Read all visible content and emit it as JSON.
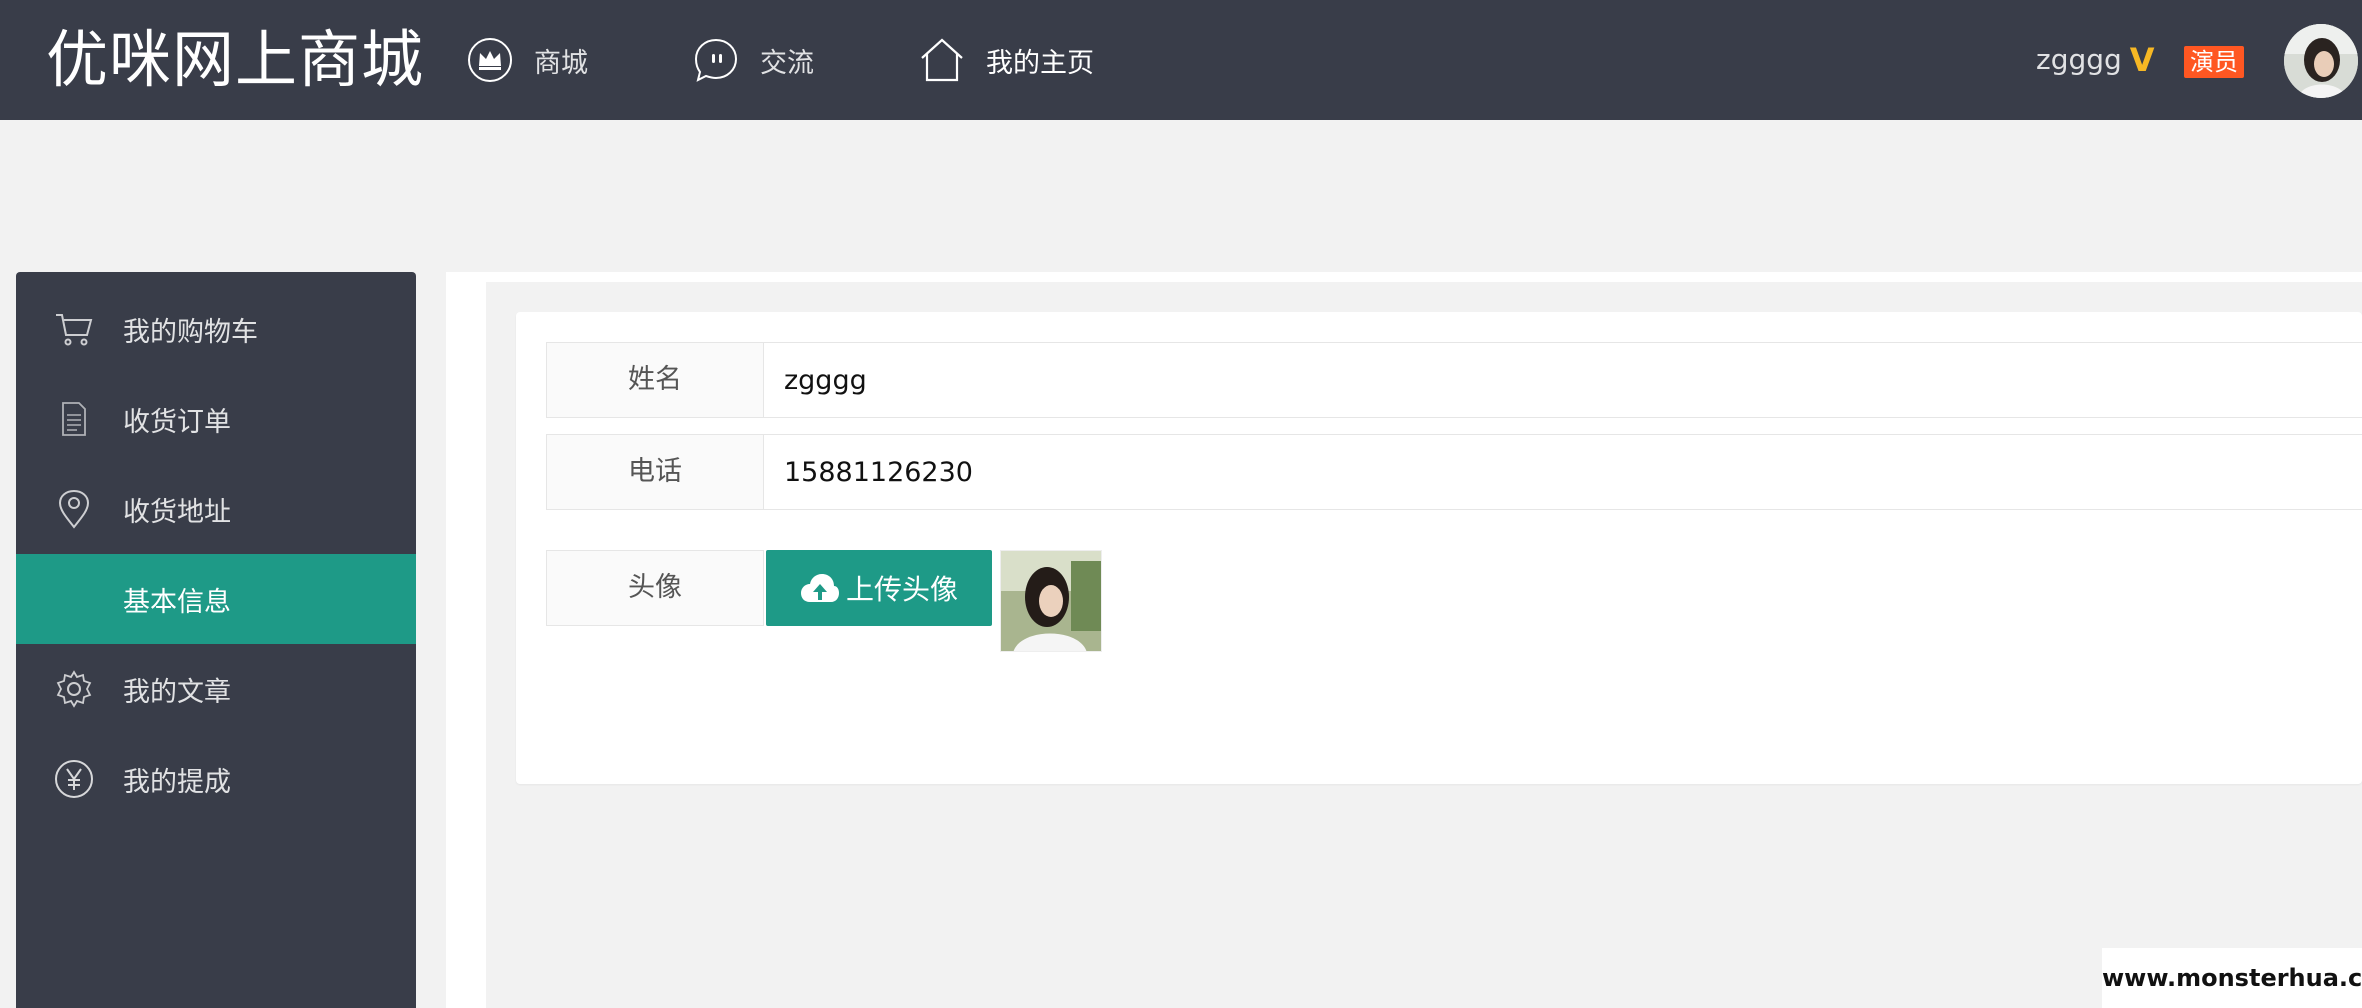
{
  "header": {
    "logo": "优咪网上商城",
    "nav": [
      {
        "label": "商城",
        "icon": "crown-icon"
      },
      {
        "label": "交流",
        "icon": "chat-bubble-icon"
      },
      {
        "label": "我的主页",
        "icon": "home-icon"
      }
    ],
    "user": {
      "name": "zgggg",
      "vip_mark": "V",
      "role_badge": "演员"
    }
  },
  "sidebar": {
    "items": [
      {
        "label": "我的购物车",
        "icon": "cart-icon"
      },
      {
        "label": "收货订单",
        "icon": "document-icon"
      },
      {
        "label": "收货地址",
        "icon": "location-pin-icon"
      },
      {
        "label": "基本信息",
        "icon": "",
        "active": true
      },
      {
        "label": "我的文章",
        "icon": "gear-icon"
      },
      {
        "label": "我的提成",
        "icon": "yen-icon"
      }
    ]
  },
  "form": {
    "name_label": "姓名",
    "name_value": "zgggg",
    "phone_label": "电话",
    "phone_value": "15881126230",
    "avatar_label": "头像",
    "upload_label": "上传头像"
  },
  "watermark": "www.monsterhua.com",
  "colors": {
    "header_bg": "#393d49",
    "accent": "#1e9a87",
    "badge": "#ff5722",
    "vip": "#f7b824"
  }
}
